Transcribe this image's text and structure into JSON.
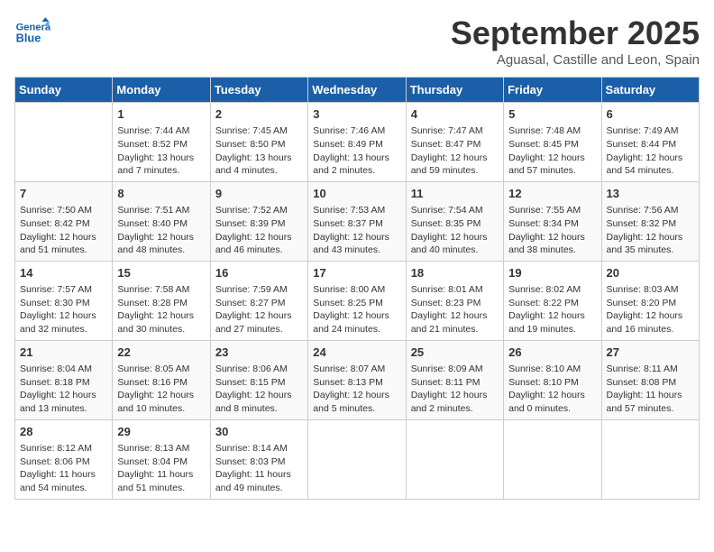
{
  "header": {
    "logo_general": "General",
    "logo_blue": "Blue",
    "month": "September 2025",
    "location": "Aguasal, Castille and Leon, Spain"
  },
  "weekdays": [
    "Sunday",
    "Monday",
    "Tuesday",
    "Wednesday",
    "Thursday",
    "Friday",
    "Saturday"
  ],
  "weeks": [
    [
      {
        "day": "",
        "sunrise": "",
        "sunset": "",
        "daylight": ""
      },
      {
        "day": "1",
        "sunrise": "Sunrise: 7:44 AM",
        "sunset": "Sunset: 8:52 PM",
        "daylight": "Daylight: 13 hours and 7 minutes."
      },
      {
        "day": "2",
        "sunrise": "Sunrise: 7:45 AM",
        "sunset": "Sunset: 8:50 PM",
        "daylight": "Daylight: 13 hours and 4 minutes."
      },
      {
        "day": "3",
        "sunrise": "Sunrise: 7:46 AM",
        "sunset": "Sunset: 8:49 PM",
        "daylight": "Daylight: 13 hours and 2 minutes."
      },
      {
        "day": "4",
        "sunrise": "Sunrise: 7:47 AM",
        "sunset": "Sunset: 8:47 PM",
        "daylight": "Daylight: 12 hours and 59 minutes."
      },
      {
        "day": "5",
        "sunrise": "Sunrise: 7:48 AM",
        "sunset": "Sunset: 8:45 PM",
        "daylight": "Daylight: 12 hours and 57 minutes."
      },
      {
        "day": "6",
        "sunrise": "Sunrise: 7:49 AM",
        "sunset": "Sunset: 8:44 PM",
        "daylight": "Daylight: 12 hours and 54 minutes."
      }
    ],
    [
      {
        "day": "7",
        "sunrise": "Sunrise: 7:50 AM",
        "sunset": "Sunset: 8:42 PM",
        "daylight": "Daylight: 12 hours and 51 minutes."
      },
      {
        "day": "8",
        "sunrise": "Sunrise: 7:51 AM",
        "sunset": "Sunset: 8:40 PM",
        "daylight": "Daylight: 12 hours and 48 minutes."
      },
      {
        "day": "9",
        "sunrise": "Sunrise: 7:52 AM",
        "sunset": "Sunset: 8:39 PM",
        "daylight": "Daylight: 12 hours and 46 minutes."
      },
      {
        "day": "10",
        "sunrise": "Sunrise: 7:53 AM",
        "sunset": "Sunset: 8:37 PM",
        "daylight": "Daylight: 12 hours and 43 minutes."
      },
      {
        "day": "11",
        "sunrise": "Sunrise: 7:54 AM",
        "sunset": "Sunset: 8:35 PM",
        "daylight": "Daylight: 12 hours and 40 minutes."
      },
      {
        "day": "12",
        "sunrise": "Sunrise: 7:55 AM",
        "sunset": "Sunset: 8:34 PM",
        "daylight": "Daylight: 12 hours and 38 minutes."
      },
      {
        "day": "13",
        "sunrise": "Sunrise: 7:56 AM",
        "sunset": "Sunset: 8:32 PM",
        "daylight": "Daylight: 12 hours and 35 minutes."
      }
    ],
    [
      {
        "day": "14",
        "sunrise": "Sunrise: 7:57 AM",
        "sunset": "Sunset: 8:30 PM",
        "daylight": "Daylight: 12 hours and 32 minutes."
      },
      {
        "day": "15",
        "sunrise": "Sunrise: 7:58 AM",
        "sunset": "Sunset: 8:28 PM",
        "daylight": "Daylight: 12 hours and 30 minutes."
      },
      {
        "day": "16",
        "sunrise": "Sunrise: 7:59 AM",
        "sunset": "Sunset: 8:27 PM",
        "daylight": "Daylight: 12 hours and 27 minutes."
      },
      {
        "day": "17",
        "sunrise": "Sunrise: 8:00 AM",
        "sunset": "Sunset: 8:25 PM",
        "daylight": "Daylight: 12 hours and 24 minutes."
      },
      {
        "day": "18",
        "sunrise": "Sunrise: 8:01 AM",
        "sunset": "Sunset: 8:23 PM",
        "daylight": "Daylight: 12 hours and 21 minutes."
      },
      {
        "day": "19",
        "sunrise": "Sunrise: 8:02 AM",
        "sunset": "Sunset: 8:22 PM",
        "daylight": "Daylight: 12 hours and 19 minutes."
      },
      {
        "day": "20",
        "sunrise": "Sunrise: 8:03 AM",
        "sunset": "Sunset: 8:20 PM",
        "daylight": "Daylight: 12 hours and 16 minutes."
      }
    ],
    [
      {
        "day": "21",
        "sunrise": "Sunrise: 8:04 AM",
        "sunset": "Sunset: 8:18 PM",
        "daylight": "Daylight: 12 hours and 13 minutes."
      },
      {
        "day": "22",
        "sunrise": "Sunrise: 8:05 AM",
        "sunset": "Sunset: 8:16 PM",
        "daylight": "Daylight: 12 hours and 10 minutes."
      },
      {
        "day": "23",
        "sunrise": "Sunrise: 8:06 AM",
        "sunset": "Sunset: 8:15 PM",
        "daylight": "Daylight: 12 hours and 8 minutes."
      },
      {
        "day": "24",
        "sunrise": "Sunrise: 8:07 AM",
        "sunset": "Sunset: 8:13 PM",
        "daylight": "Daylight: 12 hours and 5 minutes."
      },
      {
        "day": "25",
        "sunrise": "Sunrise: 8:09 AM",
        "sunset": "Sunset: 8:11 PM",
        "daylight": "Daylight: 12 hours and 2 minutes."
      },
      {
        "day": "26",
        "sunrise": "Sunrise: 8:10 AM",
        "sunset": "Sunset: 8:10 PM",
        "daylight": "Daylight: 12 hours and 0 minutes."
      },
      {
        "day": "27",
        "sunrise": "Sunrise: 8:11 AM",
        "sunset": "Sunset: 8:08 PM",
        "daylight": "Daylight: 11 hours and 57 minutes."
      }
    ],
    [
      {
        "day": "28",
        "sunrise": "Sunrise: 8:12 AM",
        "sunset": "Sunset: 8:06 PM",
        "daylight": "Daylight: 11 hours and 54 minutes."
      },
      {
        "day": "29",
        "sunrise": "Sunrise: 8:13 AM",
        "sunset": "Sunset: 8:04 PM",
        "daylight": "Daylight: 11 hours and 51 minutes."
      },
      {
        "day": "30",
        "sunrise": "Sunrise: 8:14 AM",
        "sunset": "Sunset: 8:03 PM",
        "daylight": "Daylight: 11 hours and 49 minutes."
      },
      {
        "day": "",
        "sunrise": "",
        "sunset": "",
        "daylight": ""
      },
      {
        "day": "",
        "sunrise": "",
        "sunset": "",
        "daylight": ""
      },
      {
        "day": "",
        "sunrise": "",
        "sunset": "",
        "daylight": ""
      },
      {
        "day": "",
        "sunrise": "",
        "sunset": "",
        "daylight": ""
      }
    ]
  ]
}
